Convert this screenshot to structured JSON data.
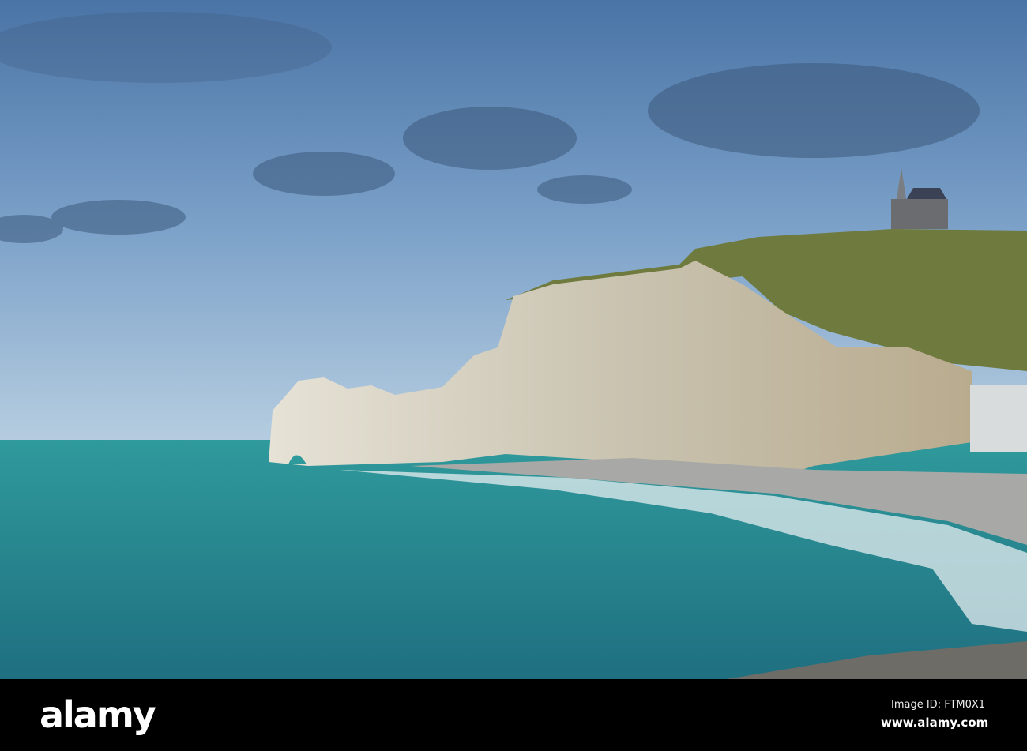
{
  "photo": {
    "subject": "chalk cliffs with arch and chapel above a turquoise sea"
  },
  "watermark": {
    "text": "alamy"
  },
  "footer": {
    "logo": "alamy",
    "image_id": "Image ID: FTM0X1",
    "url": "www.alamy.com"
  },
  "colors": {
    "sky": "#5e88b5",
    "sea": "#2a8f93",
    "cliff": "#d8d3c4",
    "grass": "#6f7a3e"
  }
}
